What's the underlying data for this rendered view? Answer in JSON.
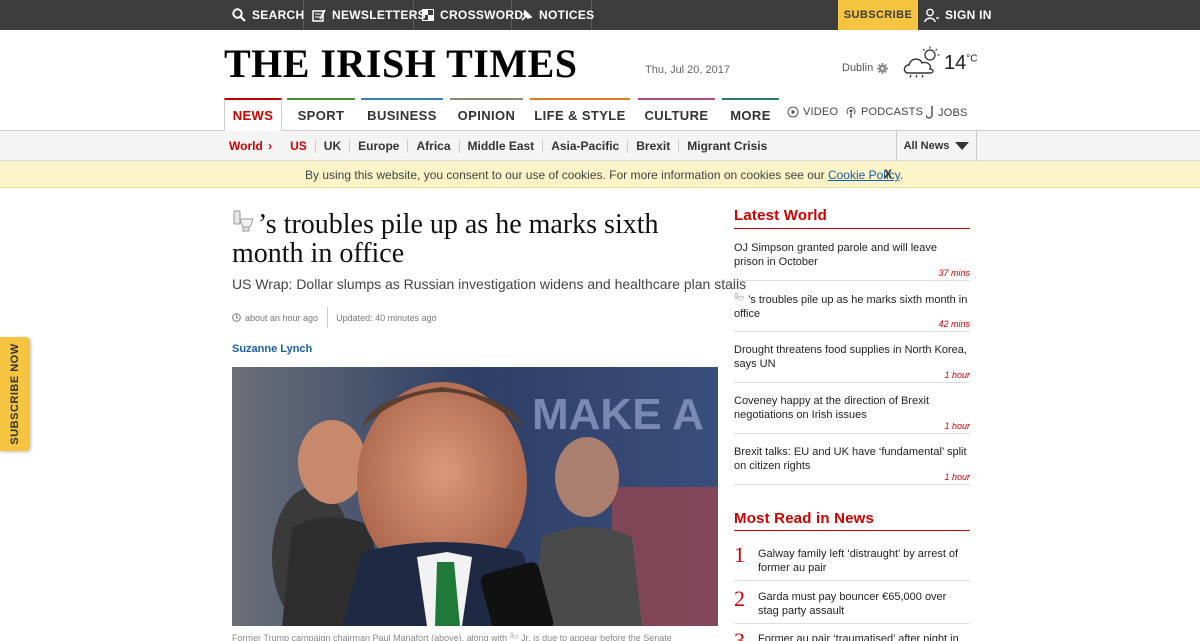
{
  "topbar": {
    "search": "SEARCH",
    "newsletters": "NEWSLETTERS",
    "crossword": "CROSSWORD",
    "notices": "NOTICES",
    "subscribe": "SUBSCRIBE",
    "sign_in": "SIGN IN"
  },
  "masthead": {
    "logo": "THE IRISH TIMES",
    "date": "Thu, Jul 20, 2017",
    "weather_city": "Dublin",
    "temperature": "14",
    "temperature_unit": "°C"
  },
  "nav": {
    "items": [
      {
        "label": "NEWS",
        "color": "#c00000"
      },
      {
        "label": "SPORT",
        "color": "#4a8f3c"
      },
      {
        "label": "BUSINESS",
        "color": "#3a7fb0"
      },
      {
        "label": "OPINION",
        "color": "#8a8a6a"
      },
      {
        "label": "LIFE & STYLE",
        "color": "#e07b22"
      },
      {
        "label": "CULTURE",
        "color": "#b04a8a"
      },
      {
        "label": "MORE",
        "color": "#2a7a7a"
      }
    ],
    "video": "VIDEO",
    "podcasts": "PODCASTS",
    "jobs": "JOBS"
  },
  "subnav": {
    "section": "World",
    "items": [
      "US",
      "UK",
      "Europe",
      "Africa",
      "Middle East",
      "Asia-Pacific",
      "Brexit",
      "Migrant Crisis"
    ],
    "all_news": "All News"
  },
  "cookie": {
    "text": "By using this website, you consent to our use of cookies. For more information on cookies see our ",
    "link": "Cookie Policy",
    "end": ".",
    "close": "X"
  },
  "side_tab": "SUBSCRIBE NOW",
  "article": {
    "headline": "’s troubles pile up as he marks sixth month in office",
    "standfirst": "US Wrap: Dollar slumps as Russian investigation widens and healthcare plan stalls",
    "published": "about an hour ago",
    "updated": "Updated: 40 minutes ago",
    "byline": "Suzanne Lynch",
    "caption_start": "Former Trump campaign chairman Paul Manafort (above), along with ",
    "caption_end": " Jr. is due to appear before the Senate"
  },
  "latest": {
    "title": "Latest World",
    "items": [
      {
        "text": "OJ Simpson granted parole and will leave prison in October",
        "time": "37 mins"
      },
      {
        "text": "’s troubles pile up as he marks sixth month in office",
        "time": "42 mins"
      },
      {
        "text": "Drought threatens food supplies in North Korea, says UN",
        "time": "1 hour"
      },
      {
        "text": "Coveney happy at the direction of Brexit negotiations on Irish issues",
        "time": "1 hour"
      },
      {
        "text": "Brexit talks: EU and UK have ‘fundamental’ split on citizen rights",
        "time": "1 hour"
      }
    ]
  },
  "most_read": {
    "title": "Most Read in News",
    "items": [
      {
        "num": "1",
        "text": "Galway family left ‘distraught’ by arrest of former au pair"
      },
      {
        "num": "2",
        "text": "Garda must pay bouncer €65,000 over stag party assault"
      },
      {
        "num": "3",
        "text": "Former au pair ‘traumatised’ after night in"
      }
    ]
  }
}
